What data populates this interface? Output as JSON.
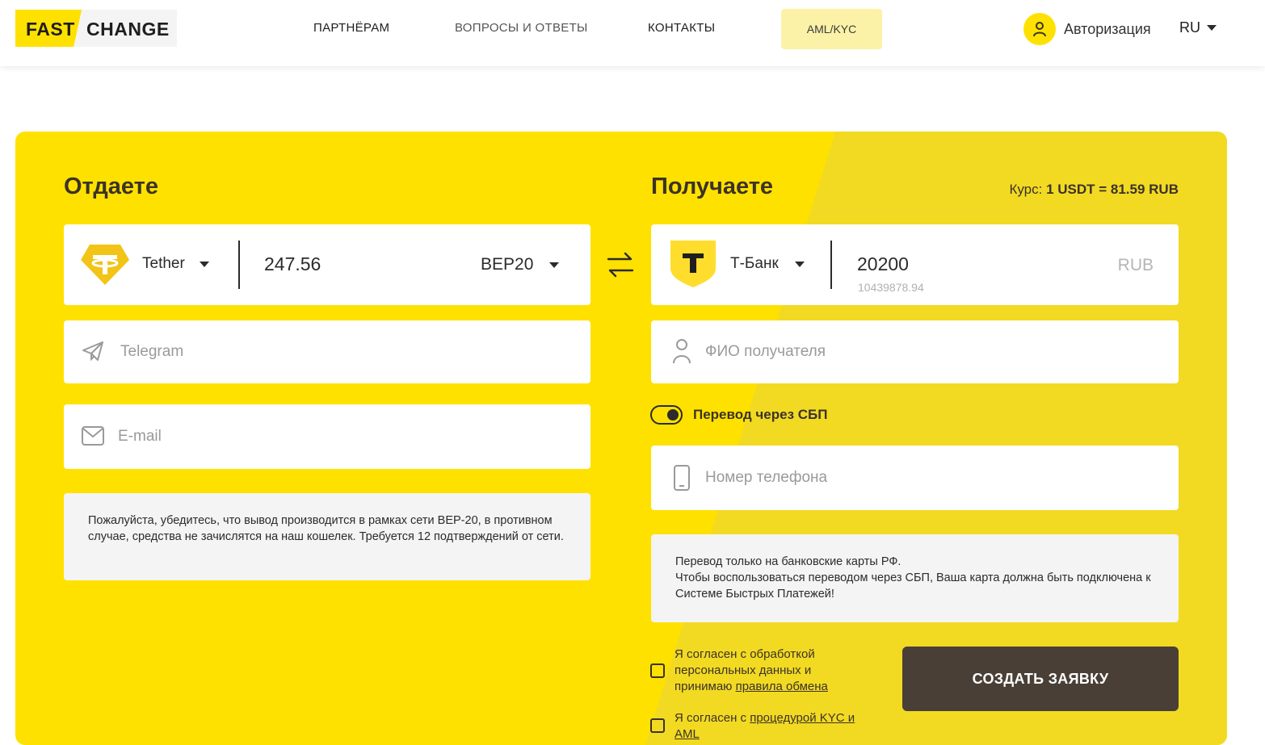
{
  "header": {
    "logo_left": "FAST",
    "logo_right": "CHANGE",
    "nav": [
      "ПАРТНЁРАМ",
      "ВОПРОСЫ И ОТВЕТЫ",
      "КОНТАКТЫ"
    ],
    "aml_label": "AML/KYC",
    "auth_label": "Авторизация",
    "lang": "RU"
  },
  "give": {
    "title": "Отдаете",
    "currency": "Tether",
    "amount": "247.56",
    "network": "BEP20",
    "telegram_placeholder": "Telegram",
    "email_placeholder": "E-mail",
    "notice": "Пожалуйста, убедитесь, что вывод производится в рамках сети BEP-20, в противном случае, средства не зачислятся на наш кошелек. Требуется 12 подтверждений от сети."
  },
  "receive": {
    "title": "Получаете",
    "rate_prefix": "Курс:",
    "rate_value": "1 USDT = 81.59 RUB",
    "bank": "Т-Банк",
    "amount": "20200",
    "reserve": "10439878.94",
    "currency": "RUB",
    "name_placeholder": "ФИО получателя",
    "sbp_label": "Перевод через СБП",
    "phone_placeholder": "Номер телефона",
    "notice_line1": "Перевод только на банковские карты РФ.",
    "notice_line2": "Чтобы воспользоваться переводом через СБП, Ваша карта должна быть подключена к Системе Быстрых Платежей!",
    "agree1_text": "Я согласен с обработкой персональных данных и принимаю",
    "agree1_link": "правила обмена",
    "agree2_text": "Я согласен с",
    "agree2_link": "процедурой KYC и AML",
    "submit_label": "СОЗДАТЬ ЗАЯВКУ"
  },
  "colors": {
    "brand_yellow": "#ffe100",
    "panel_right": "#f2da23",
    "dark_button": "#4a3f36",
    "aml_bg": "#fbf2a8"
  }
}
